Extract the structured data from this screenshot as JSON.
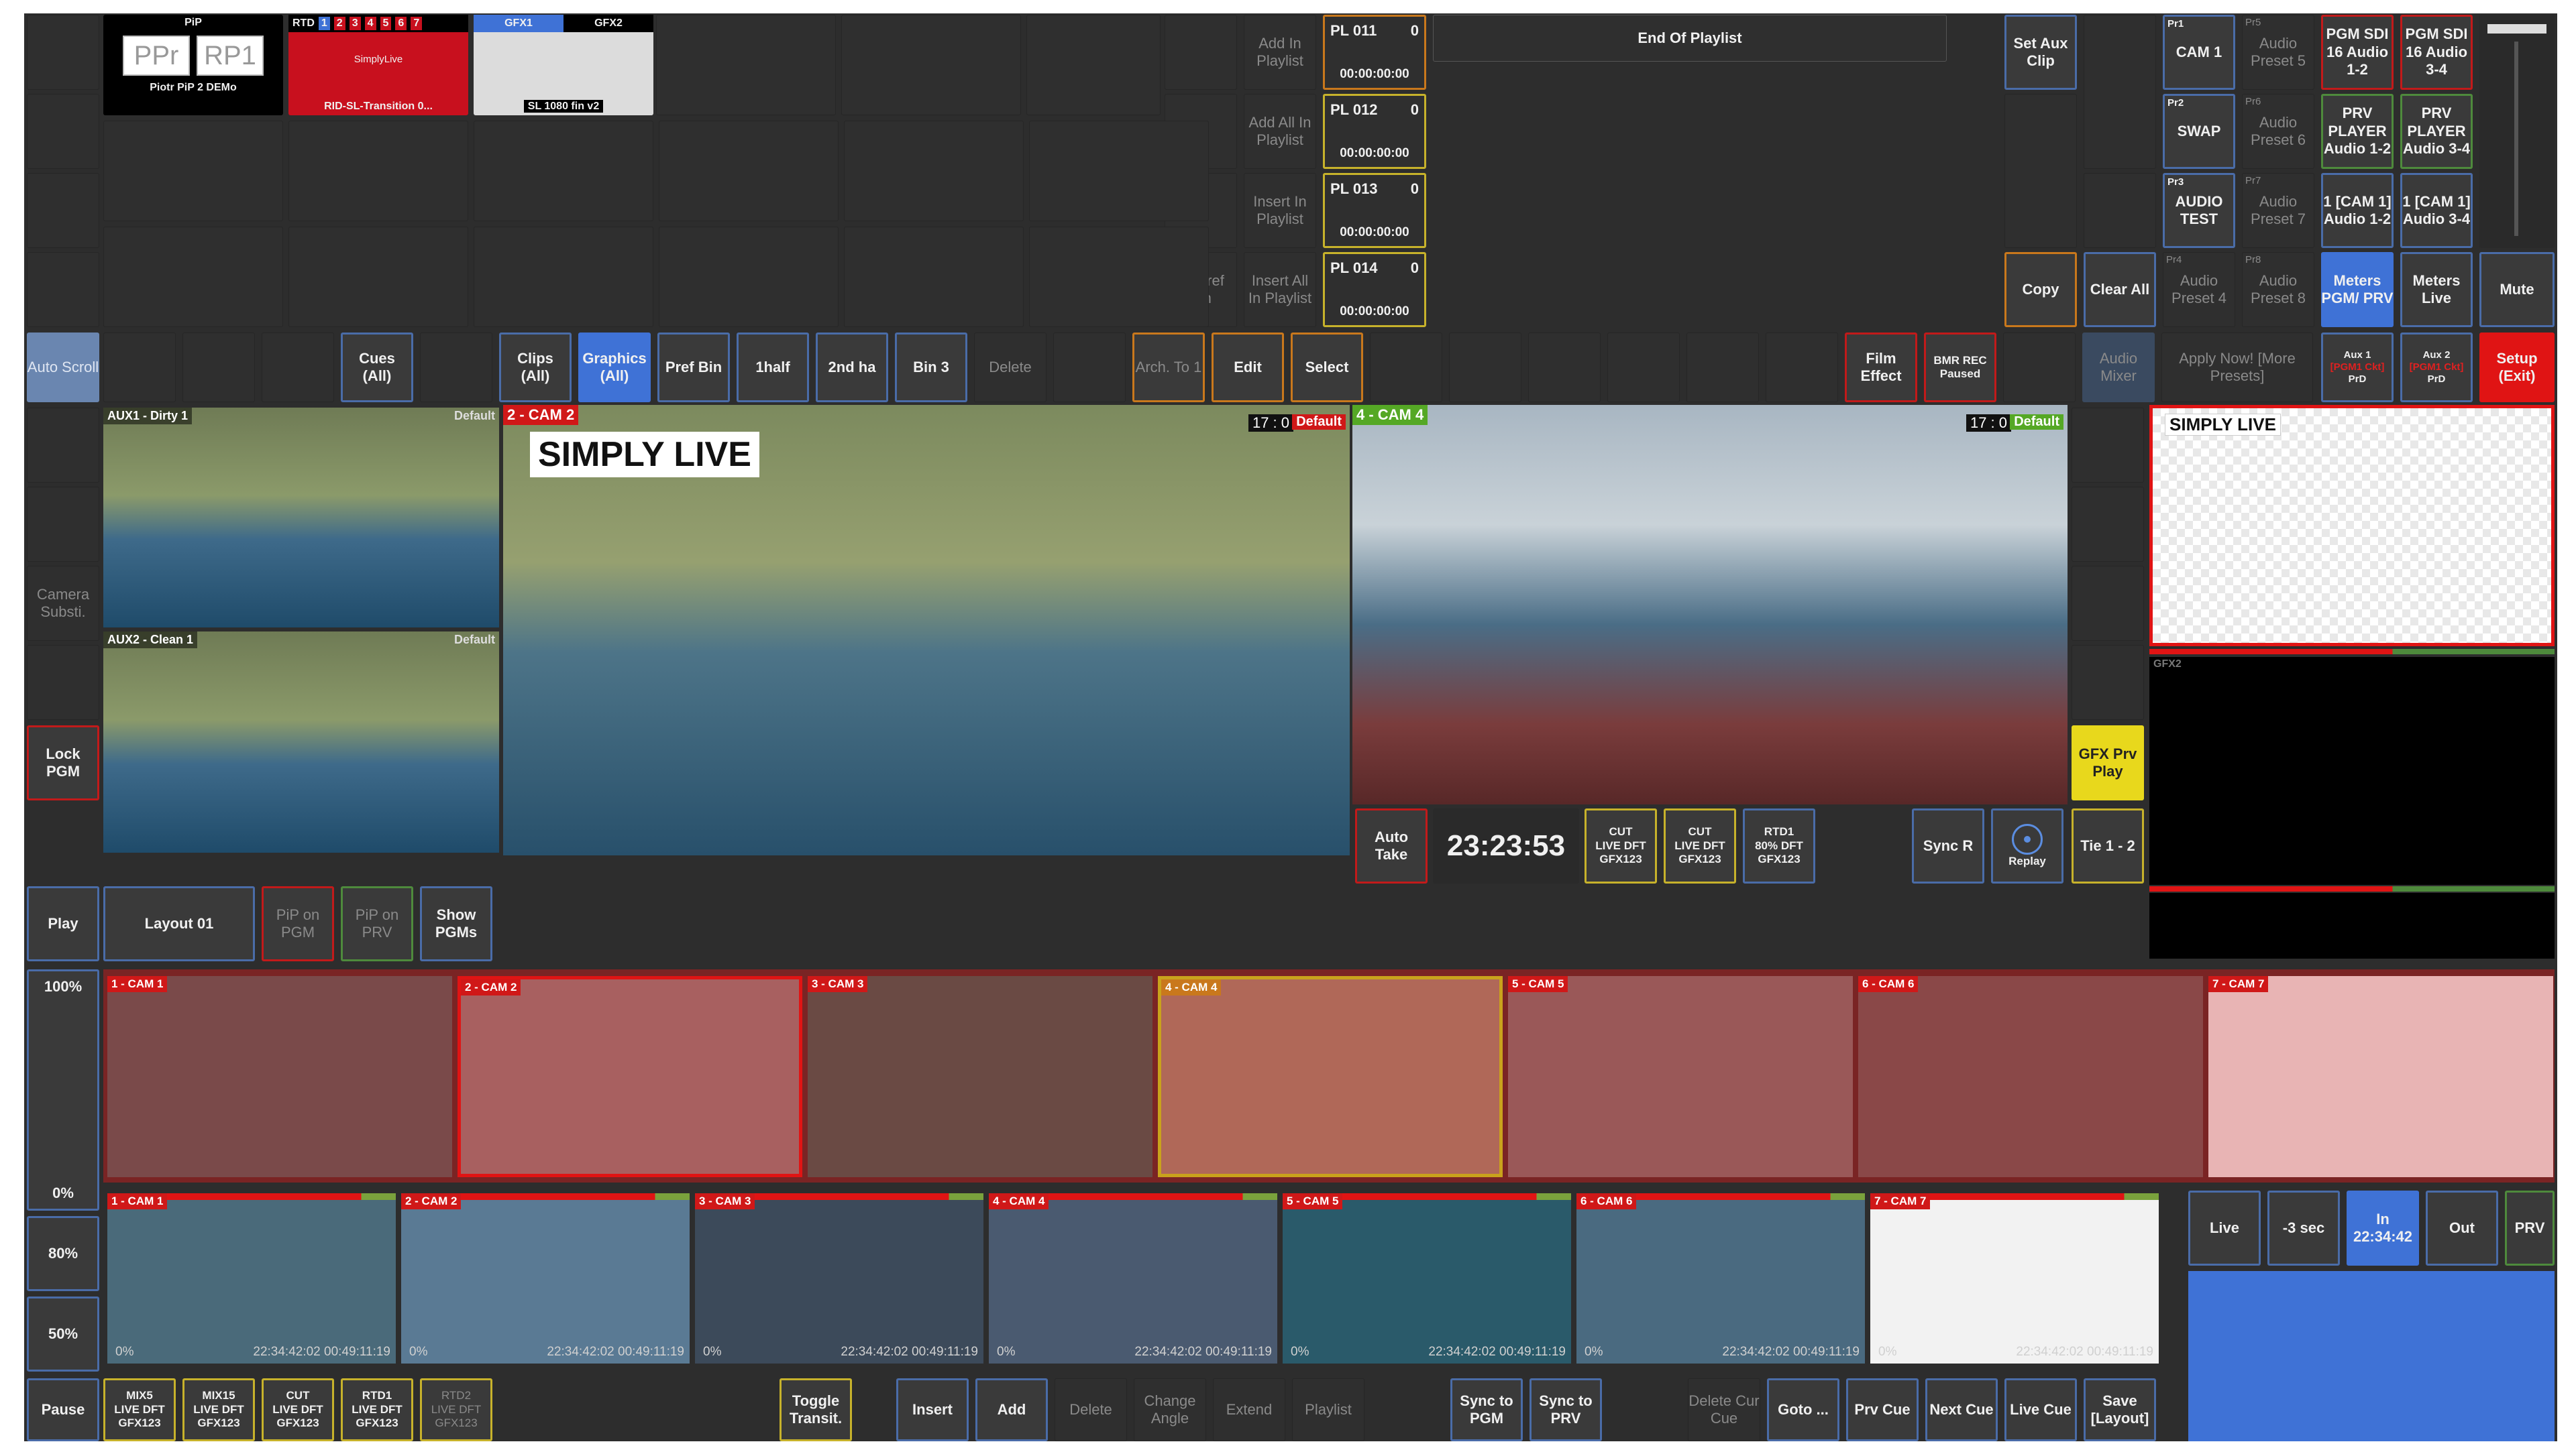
{
  "top_tiles": {
    "pip": {
      "header": "PiP",
      "a": "PPr",
      "b": "RP1",
      "caption": "Piotr PiP 2 DEMo"
    },
    "rtd": {
      "header": "RTD",
      "nums": [
        "1",
        "2",
        "3",
        "4",
        "5",
        "6",
        "7"
      ],
      "brand": "SimplyLive",
      "caption": "RID-SL-Transition 0..."
    },
    "gfx": {
      "tab1": "GFX1",
      "tab2": "GFX2",
      "caption": "SL 1080 fin v2"
    }
  },
  "playlist": {
    "buttons": [
      "Add In Playlist",
      "Add All In Playlist",
      "Insert In Playlist",
      "Insert All In Playlist"
    ],
    "to_pref_bin": "To Pref Bin",
    "entries": [
      {
        "name": "PL 011",
        "count": "0",
        "time": "00:00:00:00"
      },
      {
        "name": "PL 012",
        "count": "0",
        "time": "00:00:00:00"
      },
      {
        "name": "PL 013",
        "count": "0",
        "time": "00:00:00:00"
      },
      {
        "name": "PL 014",
        "count": "0",
        "time": "00:00:00:00"
      }
    ],
    "end": "End Of Playlist"
  },
  "aux": {
    "set_aux_clip": "Set Aux Clip",
    "copy": "Copy",
    "clear_all": "Clear All"
  },
  "presets": [
    {
      "tag": "Pr1",
      "label": "CAM 1"
    },
    {
      "tag": "Pr5",
      "label": "Audio Preset 5"
    },
    {
      "tag": "Pr2",
      "label": "SWAP"
    },
    {
      "tag": "Pr6",
      "label": "Audio Preset 6"
    },
    {
      "tag": "Pr3",
      "label": "AUDIO TEST"
    },
    {
      "tag": "Pr7",
      "label": "Audio Preset 7"
    },
    {
      "tag": "Pr4",
      "label": "Audio Preset 4"
    },
    {
      "tag": "Pr8",
      "label": "Audio Preset 8"
    }
  ],
  "audio_routes": [
    "PGM SDI 16 Audio 1-2",
    "PGM SDI 16 Audio 3-4",
    "PRV PLAYER Audio 1-2",
    "PRV PLAYER Audio 3-4",
    "1 [CAM 1] Audio 1-2",
    "1 [CAM 1] Audio 3-4"
  ],
  "meters_pgm": "Meters PGM/ PRV",
  "meters_live": "Meters Live",
  "mute": "Mute",
  "bin_bar": {
    "auto_scroll": "Auto Scroll",
    "cues": "Cues (All)",
    "clips": "Clips (All)",
    "graphics": "Graphics (All)",
    "pref_bin": "Pref Bin",
    "half1": "1half",
    "half2": "2nd ha",
    "bin3": "Bin 3",
    "delete": "Delete",
    "arch_to": "Arch. To 1",
    "edit": "Edit",
    "select": "Select",
    "film_effect": "Film Effect",
    "bmr_rec": "BMR REC Paused",
    "audio_mixer": "Audio Mixer",
    "apply_now": "Apply Now! [More Presets]",
    "aux1": "Aux 1",
    "aux1_sub": "[PGM1 Ckt]",
    "aux2": "Aux 2",
    "aux2_sub": "[PGM1 Ckt]",
    "prd": "PrD",
    "setup": "Setup (Exit)"
  },
  "left_col": {
    "camera_subst": "Camera Substi.",
    "lock_pgm": "Lock PGM",
    "play": "Play",
    "pause": "Pause"
  },
  "monitors": {
    "aux1": "AUX1 - Dirty 1",
    "aux2": "AUX2 - Clean 1",
    "default": "Default",
    "cam2": "2 - CAM 2",
    "cam4": "4 - CAM 4",
    "simply_live": "SIMPLY LIVE",
    "tc1": "17 : 0",
    "tc2": "17 : 0",
    "gfx2": "GFX2"
  },
  "controls": {
    "auto_take": "Auto Take",
    "clock": "23:23:53",
    "effects": [
      {
        "l1": "CUT",
        "l2": "LIVE DFT",
        "l3": "GFX123"
      },
      {
        "l1": "CUT",
        "l2": "LIVE DFT",
        "l3": "GFX123"
      },
      {
        "l1": "RTD1",
        "l2": "80% DFT",
        "l3": "GFX123"
      }
    ],
    "sync_r": "Sync R",
    "replay": "Replay",
    "tie": "Tie 1 - 2",
    "gfx_prv_play": "GFX Prv Play"
  },
  "layout": {
    "name": "Layout 01",
    "pip_pgm": "PiP on PGM",
    "pip_prv": "PiP on PRV",
    "show_pgms": "Show PGMs"
  },
  "speeds": [
    "100%",
    "0%",
    "80%",
    "50%"
  ],
  "cams_top": [
    "1 - CAM 1",
    "2 - CAM 2",
    "3 - CAM 3",
    "4 - CAM 4",
    "5 - CAM 5",
    "6 - CAM 6",
    "7 - CAM 7"
  ],
  "cams_bottom": [
    {
      "label": "1 - CAM 1",
      "pct": "0%",
      "tc": "22:34:42:02  00:49:11:19"
    },
    {
      "label": "2 - CAM 2",
      "pct": "0%",
      "tc": "22:34:42:02  00:49:11:19"
    },
    {
      "label": "3 - CAM 3",
      "pct": "0%",
      "tc": "22:34:42:02  00:49:11:19"
    },
    {
      "label": "4 - CAM 4",
      "pct": "0%",
      "tc": "22:34:42:02  00:49:11:19"
    },
    {
      "label": "5 - CAM 5",
      "pct": "0%",
      "tc": "22:34:42:02  00:49:11:19"
    },
    {
      "label": "6 - CAM 6",
      "pct": "0%",
      "tc": "22:34:42:02  00:49:11:19"
    },
    {
      "label": "7 - CAM 7",
      "pct": "0%",
      "tc": "22:34:42:02  00:49:11:19"
    }
  ],
  "transport": {
    "live": "Live",
    "minus3": "-3 sec",
    "in": "In",
    "in_tc": "22:34:42",
    "out": "Out",
    "prv": "PRV"
  },
  "bottom_bar": {
    "effects": [
      {
        "l1": "MIX5",
        "l2": "LIVE DFT",
        "l3": "GFX123"
      },
      {
        "l1": "MIX15",
        "l2": "LIVE DFT",
        "l3": "GFX123"
      },
      {
        "l1": "CUT",
        "l2": "LIVE DFT",
        "l3": "GFX123"
      },
      {
        "l1": "RTD1",
        "l2": "LIVE DFT",
        "l3": "GFX123"
      },
      {
        "l1": "RTD2",
        "l2": "LIVE DFT",
        "l3": "GFX123"
      }
    ],
    "toggle": "Toggle Transit.",
    "insert": "Insert",
    "add": "Add",
    "delete": "Delete",
    "change_angle": "Change Angle",
    "extend": "Extend",
    "playlist": "Playlist",
    "sync_pgm": "Sync to PGM",
    "sync_prv": "Sync to PRV",
    "delete_cue": "Delete Cur Cue",
    "goto": "Goto ...",
    "prv_cue": "Prv Cue",
    "next_cue": "Next Cue",
    "live_cue": "Live Cue",
    "save": "Save [Layout]"
  }
}
